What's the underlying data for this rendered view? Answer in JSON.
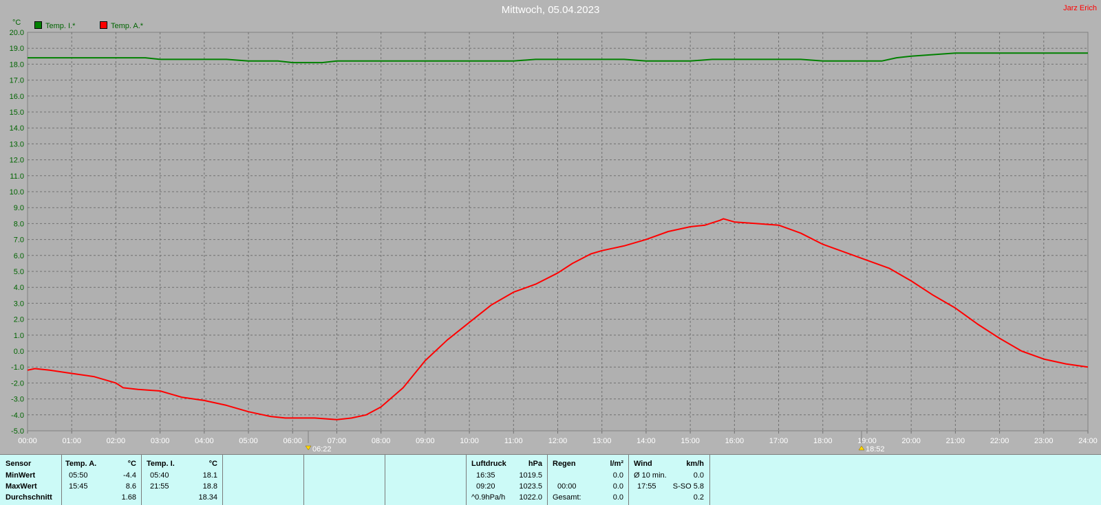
{
  "header": {
    "title": "Mittwoch, 05.04.2023",
    "author": "Jarz Erich",
    "unit": "°C"
  },
  "legend": [
    {
      "label": "Temp. I.*",
      "color": "#006400"
    },
    {
      "label": "Temp. A.*",
      "color": "#ff0000"
    }
  ],
  "sun": {
    "sunrise": "06:22",
    "sunset": "18:52"
  },
  "chart_data": {
    "type": "line",
    "title": "Mittwoch, 05.04.2023",
    "ylabel": "°C",
    "ylim": [
      -5.0,
      20.0
    ],
    "ytick_step": 1.0,
    "xlim_hours": [
      0,
      24
    ],
    "x_ticks": [
      "00:00",
      "01:00",
      "02:00",
      "03:00",
      "04:00",
      "05:00",
      "06:00",
      "07:00",
      "08:00",
      "09:00",
      "10:00",
      "11:00",
      "12:00",
      "13:00",
      "14:00",
      "15:00",
      "16:00",
      "17:00",
      "18:00",
      "19:00",
      "20:00",
      "21:00",
      "22:00",
      "23:00",
      "24:00"
    ],
    "grid": true,
    "legend_position": "top-left",
    "series": [
      {
        "name": "Temp. I.*",
        "color": "#006400",
        "x": [
          "00:00",
          "01:00",
          "02:00",
          "02:40",
          "03:00",
          "04:00",
          "04:30",
          "05:00",
          "05:40",
          "06:00",
          "06:40",
          "07:00",
          "08:00",
          "09:00",
          "10:00",
          "11:00",
          "11:30",
          "12:00",
          "13:00",
          "13:30",
          "14:00",
          "14:30",
          "15:00",
          "15:30",
          "16:00",
          "16:30",
          "17:00",
          "17:30",
          "18:00",
          "18:30",
          "19:00",
          "19:20",
          "19:40",
          "20:00",
          "20:30",
          "21:00",
          "22:00",
          "23:00",
          "24:00"
        ],
        "values": [
          18.4,
          18.4,
          18.4,
          18.4,
          18.3,
          18.3,
          18.3,
          18.2,
          18.2,
          18.1,
          18.1,
          18.2,
          18.2,
          18.2,
          18.2,
          18.2,
          18.3,
          18.3,
          18.3,
          18.3,
          18.2,
          18.2,
          18.2,
          18.3,
          18.3,
          18.3,
          18.3,
          18.3,
          18.2,
          18.2,
          18.2,
          18.2,
          18.4,
          18.5,
          18.6,
          18.7,
          18.7,
          18.7,
          18.7
        ]
      },
      {
        "name": "Temp. A.*",
        "color": "#ff0000",
        "x": [
          "00:00",
          "00:10",
          "00:30",
          "01:00",
          "01:30",
          "02:00",
          "02:10",
          "02:30",
          "03:00",
          "03:30",
          "04:00",
          "04:30",
          "05:00",
          "05:30",
          "05:50",
          "06:30",
          "07:00",
          "07:20",
          "07:40",
          "08:00",
          "08:30",
          "09:00",
          "09:30",
          "10:00",
          "10:30",
          "11:00",
          "11:30",
          "12:00",
          "12:20",
          "12:45",
          "13:00",
          "13:30",
          "14:00",
          "14:30",
          "15:00",
          "15:20",
          "15:40",
          "15:45",
          "16:00",
          "16:30",
          "17:00",
          "17:30",
          "18:00",
          "18:30",
          "19:00",
          "19:30",
          "20:00",
          "20:30",
          "21:00",
          "21:30",
          "22:00",
          "22:30",
          "23:00",
          "23:30",
          "24:00"
        ],
        "values": [
          -1.2,
          -1.1,
          -1.2,
          -1.4,
          -1.6,
          -2.0,
          -2.3,
          -2.4,
          -2.5,
          -2.9,
          -3.1,
          -3.4,
          -3.8,
          -4.1,
          -4.2,
          -4.2,
          -4.3,
          -4.2,
          -4.0,
          -3.5,
          -2.3,
          -0.6,
          0.7,
          1.8,
          2.9,
          3.7,
          4.2,
          4.9,
          5.5,
          6.1,
          6.3,
          6.6,
          7.0,
          7.5,
          7.8,
          7.9,
          8.2,
          8.3,
          8.1,
          8.0,
          7.9,
          7.4,
          6.7,
          6.2,
          5.7,
          5.2,
          4.4,
          3.5,
          2.7,
          1.7,
          0.8,
          0.0,
          -0.5,
          -0.8,
          -1.0
        ]
      }
    ]
  },
  "stats": {
    "sensor": {
      "header": "Sensor",
      "rows": [
        "MinWert",
        "MaxWert",
        "Durchschnitt"
      ]
    },
    "temp_a": {
      "header": "Temp. A.",
      "unit": "°C",
      "min_time": "05:50",
      "min_val": "-4.4",
      "max_time": "15:45",
      "max_val": "8.6",
      "avg": "1.68"
    },
    "temp_i": {
      "header": "Temp. I.",
      "unit": "°C",
      "min_time": "05:40",
      "min_val": "18.1",
      "max_time": "21:55",
      "max_val": "18.8",
      "avg": "18.34"
    },
    "luftdruck": {
      "header": "Luftdruck",
      "unit": "hPa",
      "r1_label": "16:35",
      "r1_val": "1019.5",
      "r2_label": "09:20",
      "r2_val": "1023.5",
      "r3_label": "^0.9hPa/h",
      "r3_val": "1022.0"
    },
    "regen": {
      "header": "Regen",
      "unit": "l/m²",
      "r2_label": "00:00",
      "r2_val": "0.0",
      "r3_label": "Gesamt:",
      "r3_val": "0.0",
      "r1_val": "0.0"
    },
    "wind": {
      "header": "Wind",
      "unit": "km/h",
      "r1_label": "Ø 10 min.",
      "r1_val": "0.0",
      "r2_label": "17:55",
      "r2_val": "S-SO 5.8",
      "r3_val": "0.2"
    }
  }
}
